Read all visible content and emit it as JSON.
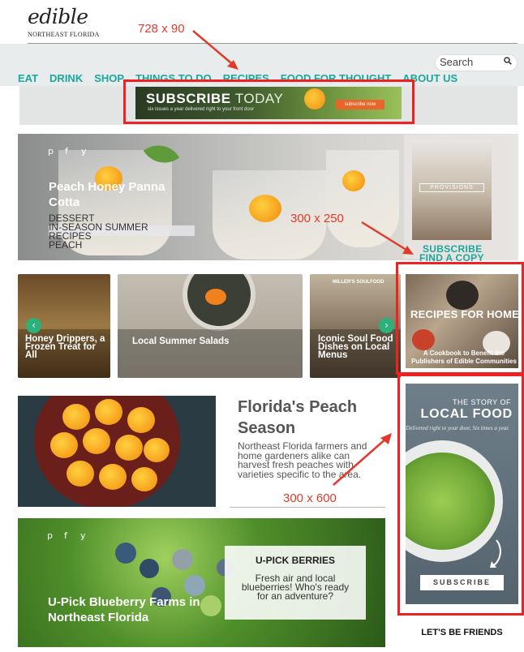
{
  "header": {
    "logo": "edible",
    "logo_sub": "NORTHEAST FLORIDA",
    "nav": [
      "EAT",
      "DRINK",
      "SHOP",
      "THINGS TO DO",
      "RECIPES",
      "FOOD FOR THOUGHT",
      "ABOUT US"
    ],
    "search_placeholder": "Search"
  },
  "annotations": {
    "banner_size": "728 x 90",
    "box_size": "300 x 250",
    "tall_size": "300 x 600",
    "color": "#e23a2a"
  },
  "banner": {
    "title_a": "SUBSCRIBE",
    "title_b": "TODAY",
    "sub": "six issues a year delivered right to your front door",
    "button": "subscribe now"
  },
  "hero": {
    "social": [
      "p",
      "f",
      "y"
    ],
    "title": "Peach Honey Panna Cotta",
    "tags": [
      "DESSERT",
      "IN-SEASON SUMMER",
      "RECIPES",
      "PEACH"
    ]
  },
  "provisions": {
    "label": "PROVISIONS",
    "subscribe": "SUBSCRIBE",
    "find_copy": "FIND A COPY"
  },
  "cards": [
    {
      "caption": "Honey Drippers, a Frozen Treat for All"
    },
    {
      "caption": "Local Summer Salads"
    },
    {
      "caption": "Iconic Soul Food Dishes on Local Menus",
      "sign": "MILLER'S SOULFOOD"
    }
  ],
  "recipes_ad": {
    "title": "RECIPES FOR HOME",
    "sub": "A Cookbook to Benefit the Publishers of Edible Communities"
  },
  "peach_feature": {
    "title": "Florida's Peach Season",
    "text": "Northeast Florida farmers and home gardeners alike can harvest fresh peaches with varieties specific to the area."
  },
  "berries": {
    "social": [
      "p",
      "f",
      "y"
    ],
    "box_title": "U-PICK BERRIES",
    "box_text": "Fresh air and local blueberries! Who's ready for an adventure?",
    "title": "U-Pick Blueberry Farms in Northeast Florida"
  },
  "local_food_ad": {
    "small": "THE STORY OF",
    "big": "LOCAL FOOD",
    "italic": "Delivered right to your door, Six times a year.",
    "button": "SUBSCRIBE"
  },
  "friends": "LET'S BE FRIENDS"
}
